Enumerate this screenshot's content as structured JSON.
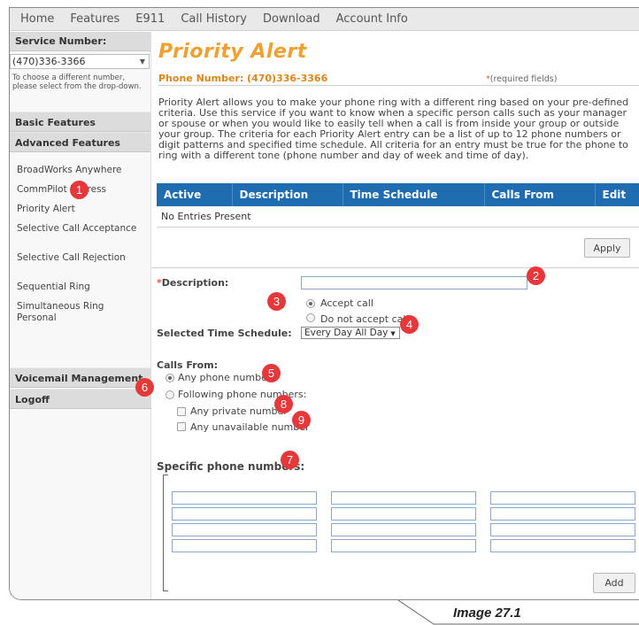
{
  "nav": [
    "Home",
    "Features",
    "E911",
    "Call History",
    "Download",
    "Account Info"
  ],
  "sidebar": {
    "service_header": "Service Number:",
    "service_selected": "(470)336-3366",
    "hint": "To choose a different number, please select from the drop-down.",
    "basic": "Basic Features",
    "advanced": "Advanced Features",
    "links": [
      "BroadWorks Anywhere",
      "CommPilot Express",
      "Priority Alert",
      "Selective Call Acceptance",
      "Selective Call Rejection",
      "Sequential Ring",
      "Simultaneous Ring Personal"
    ],
    "voicemail": "Voicemail Management",
    "logoff": "Logoff"
  },
  "main": {
    "title": "Priority Alert",
    "phone_label": "Phone Number: (470)336-3366",
    "required_star": "*",
    "required_note": "(required fields)",
    "intro": "Priority Alert allows you to make your phone ring with a different ring based on your pre-defined criteria. Use this service if you want to know when a specific person calls such as your manager or spouse or when you would like to easily tell when a call is from inside your group or outside your group. The criteria for each Priority Alert entry can be a list of up to 12 phone numbers or digit patterns and specified time schedule. All criteria for an entry must be true for the phone to ring with a different tone (phone number and day of week and time of day).",
    "table_headers": [
      "Active",
      "Description",
      "Time Schedule",
      "Calls From",
      "Edit"
    ],
    "empty_row": "No Entries Present",
    "apply": "Apply",
    "description_star": "*",
    "description_label": "Description:",
    "accept": "Accept call",
    "reject": "Do not accept call",
    "schedule_label": "Selected Time Schedule:",
    "schedule_value": "Every Day All Day",
    "calls_from": "Calls From:",
    "any_phone": "Any phone number",
    "following": "Following phone numbers:",
    "private": "Any private number",
    "unavailable": "Any unavailable number",
    "specific": "Specific phone numbers:",
    "add": "Add"
  },
  "badges": [
    "1",
    "2",
    "3",
    "4",
    "5",
    "6",
    "7",
    "8",
    "9"
  ],
  "caption": "Image 27.1"
}
